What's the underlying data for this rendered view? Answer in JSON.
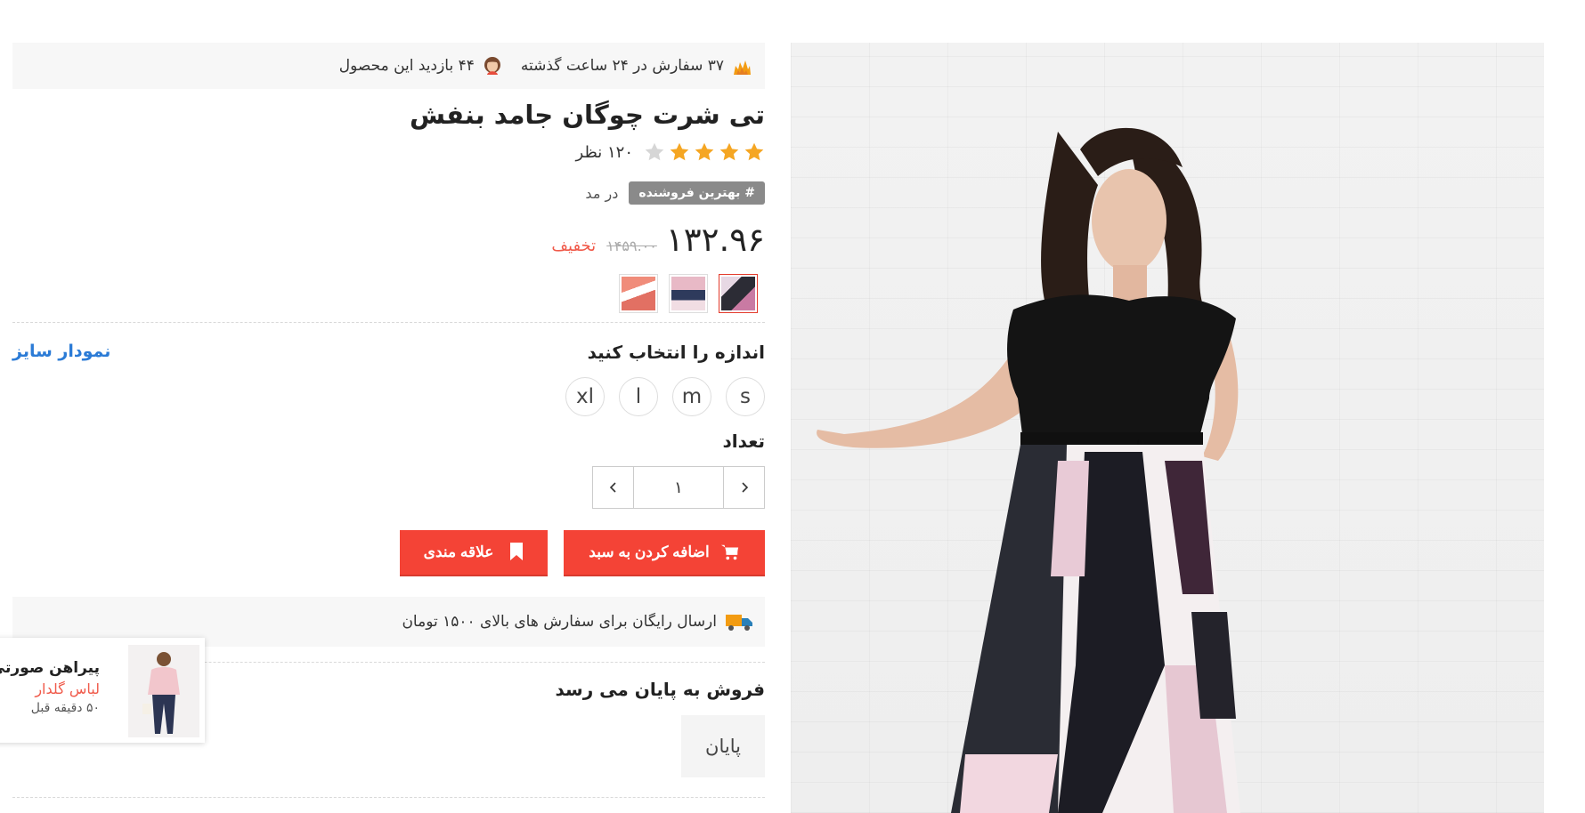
{
  "stats": {
    "orders_text": "۳۷ سفارش در ۲۴ ساعت گذشته",
    "views_text": "۴۴ بازدید این محصول"
  },
  "product": {
    "title": "تی شرت چوگان جامد بنفش",
    "rating": 4,
    "rating_max": 5,
    "review_count": "۱۲۰ نظر",
    "badge": "# بهترین فروشنده",
    "badge_tag": "در مد",
    "price": "۱۳۲.۹۶",
    "old_price": "۱۴۵۹.۰۰",
    "discount_label": "تخفیف"
  },
  "size_section": {
    "label": "اندازه را انتخاب کنید",
    "chart_link": "نمودار سایز",
    "options": [
      "s",
      "m",
      "l",
      "xl"
    ]
  },
  "quantity": {
    "label": "تعداد",
    "value": "۱"
  },
  "buttons": {
    "add_to_cart": "اضافه کردن به سبد",
    "wishlist": "علاقه مندی"
  },
  "shipping": {
    "text": "ارسال رایگان برای سفارش های بالای ۱۵۰۰ تومان"
  },
  "sale": {
    "label": "فروش به پایان می رسد",
    "countdown": "پایان"
  },
  "recent_purchase": {
    "name": "پیراهن صورتی زنانه",
    "category": "لباس گلدار",
    "time": "۵۰ دقیقه قبل"
  },
  "colors": {
    "accent": "#f44336",
    "link": "#2b7bd6",
    "star": "#f5a623",
    "star_empty": "#d6d6d6",
    "discount": "#f05a4a"
  }
}
